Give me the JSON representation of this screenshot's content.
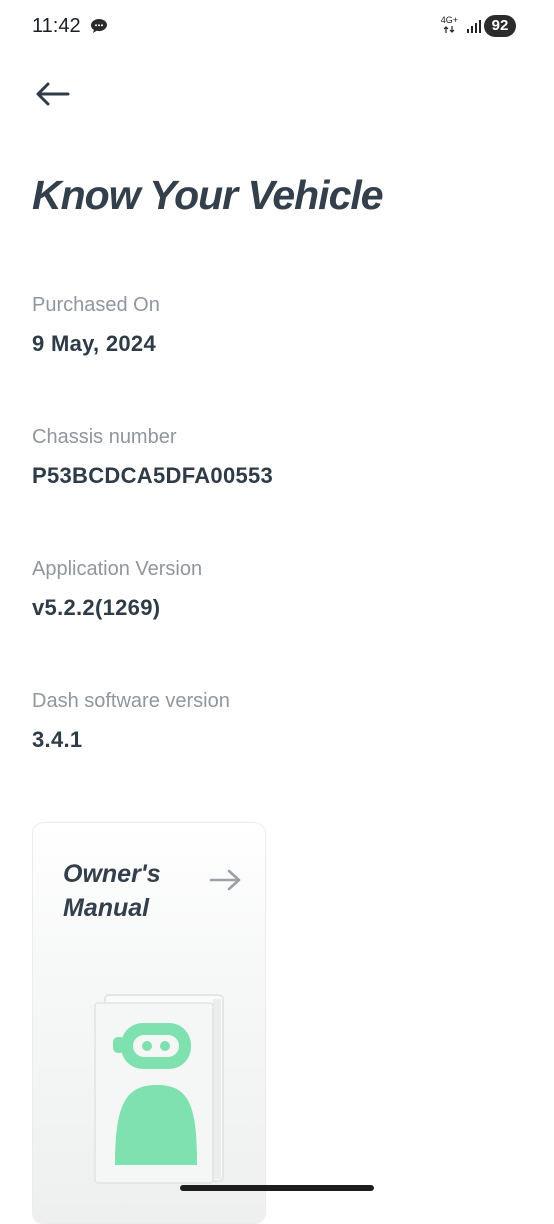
{
  "status_bar": {
    "time": "11:42",
    "network_type": "4G+",
    "battery": "92",
    "icons": [
      "chat-bubble-icon",
      "data-arrows-icon",
      "signal-bars-icon",
      "battery-icon"
    ]
  },
  "header": {
    "back_icon": "arrow-left-icon",
    "title": "Know Your Vehicle"
  },
  "details": [
    {
      "label": "Purchased On",
      "value": "9 May, 2024"
    },
    {
      "label": "Chassis number",
      "value": "P53BCDCA5DFA00553"
    },
    {
      "label": "Application Version",
      "value": "v5.2.2(1269)"
    },
    {
      "label": "Dash software version",
      "value": "3.4.1"
    }
  ],
  "manual_card": {
    "title": "Owner's Manual",
    "arrow_icon": "arrow-right-icon",
    "illustration": "manual-book-robot-illustration",
    "accent_color": "#7fe0b0"
  }
}
